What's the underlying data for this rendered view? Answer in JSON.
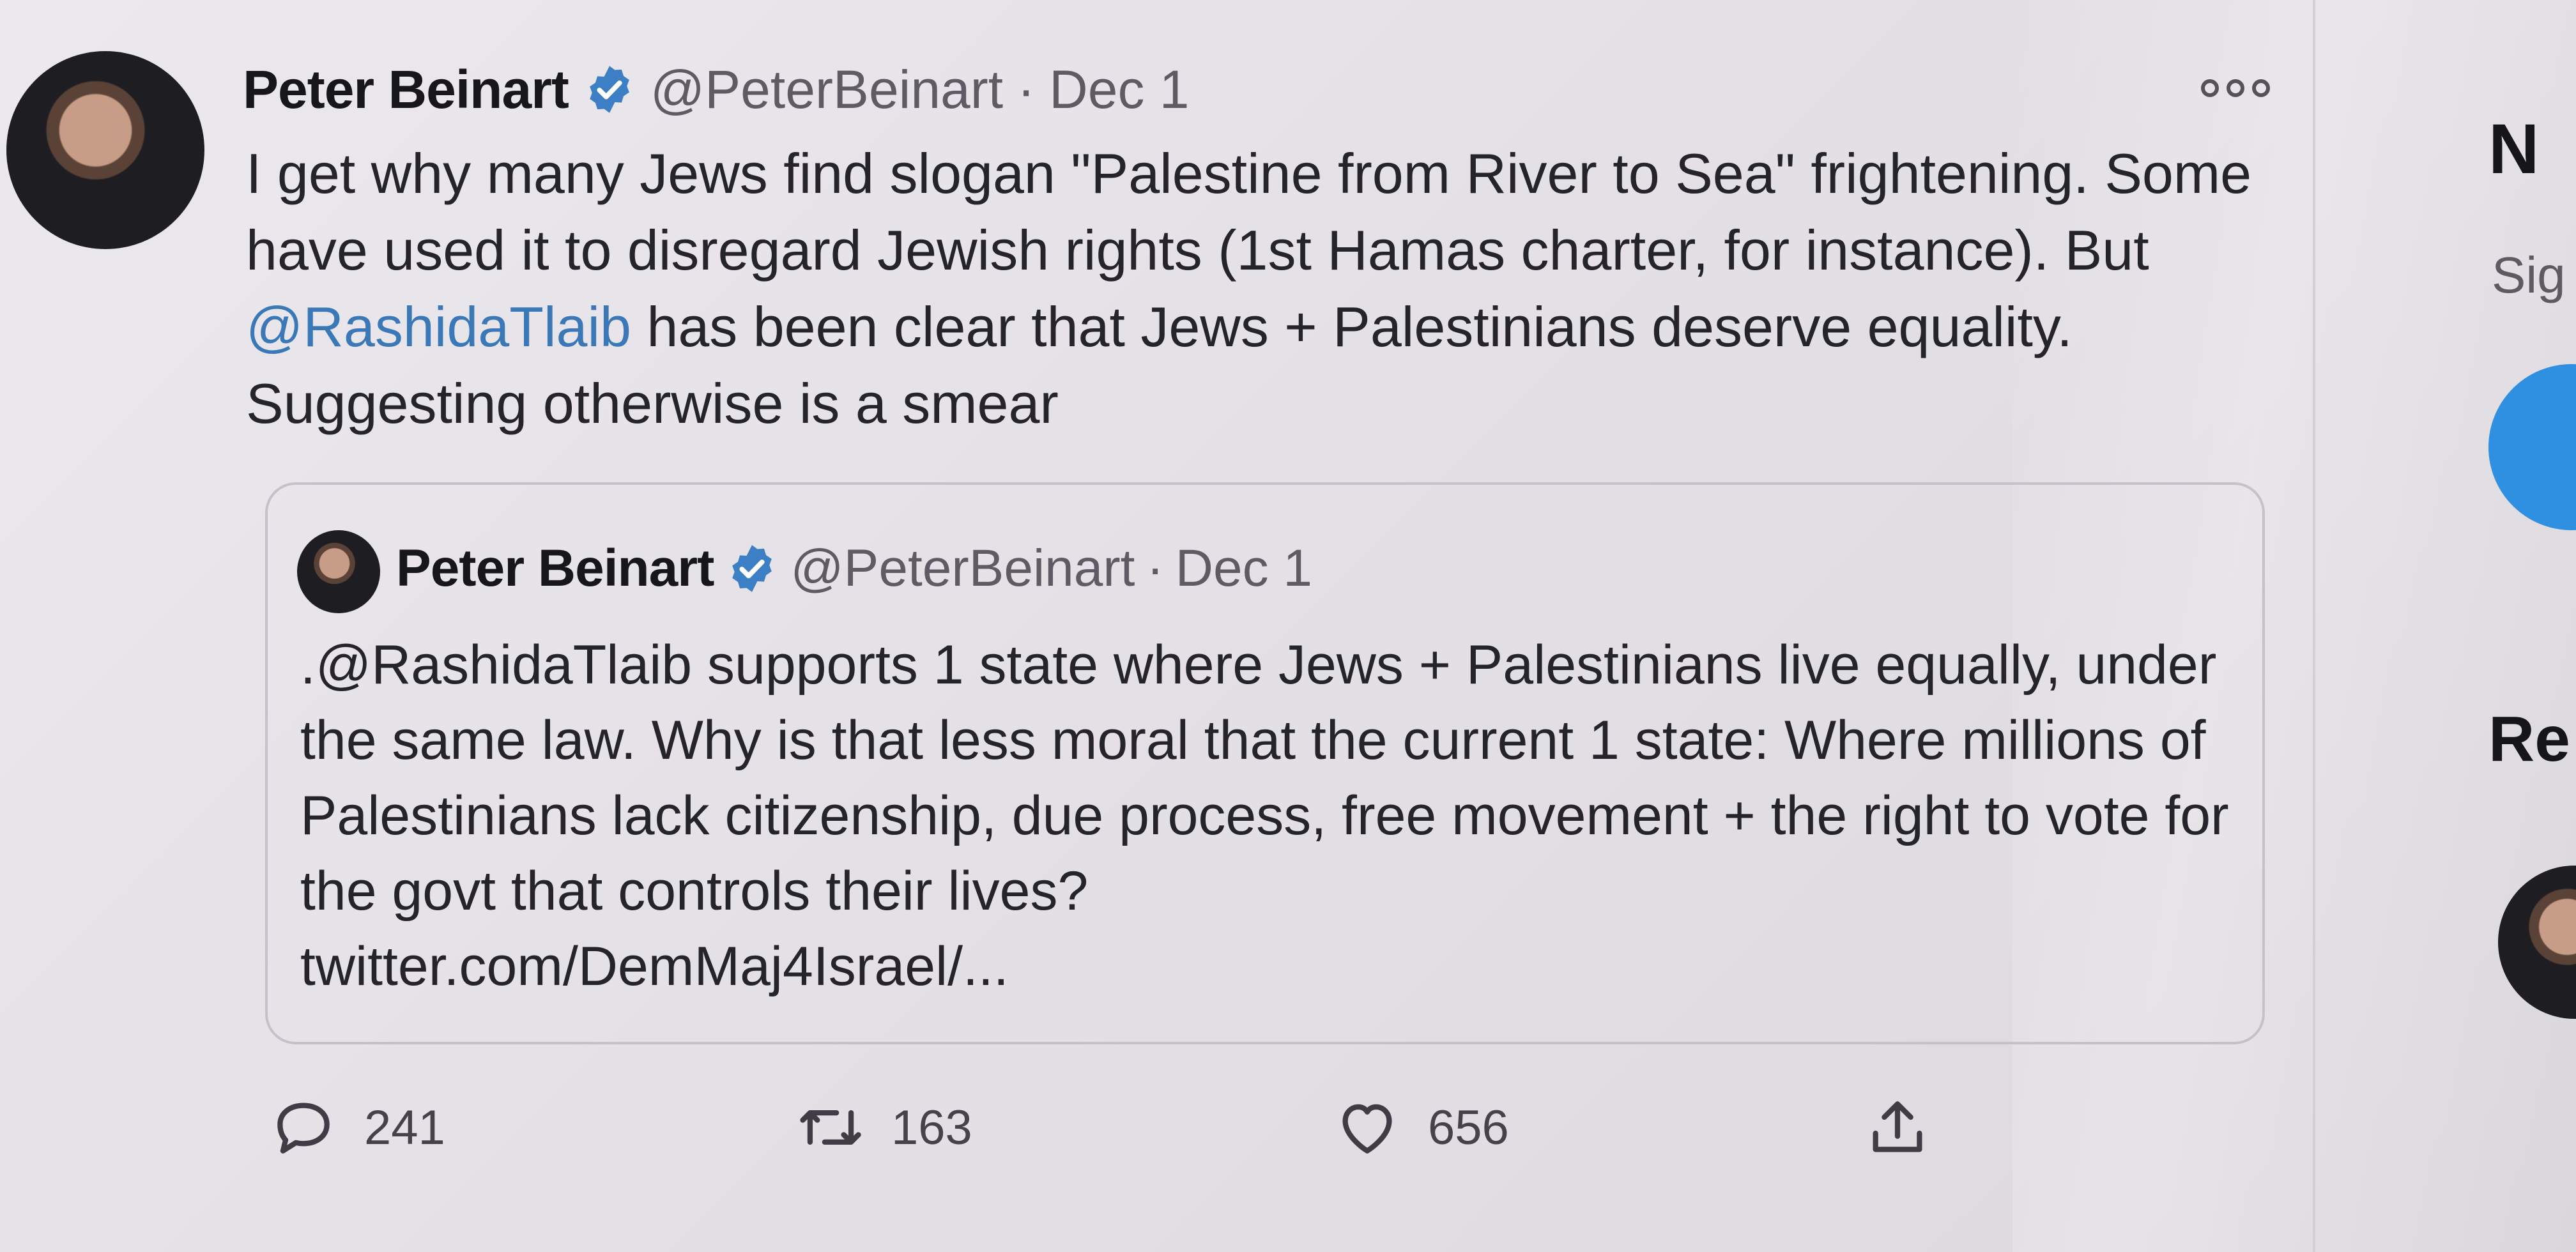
{
  "tweet": {
    "author_name": "Peter Beinart",
    "handle": "@PeterBeinart",
    "separator": "·",
    "date": "Dec 1",
    "text_before_mention": "I get why many Jews find slogan \"Palestine from River to Sea\" frightening. Some have used it to disregard Jewish rights (1st Hamas charter, for instance). But ",
    "mention": "@RashidaTlaib",
    "text_after_mention": " has been clear that Jews + Palestinians deserve equality. Suggesting otherwise is a smear"
  },
  "quoted_tweet": {
    "author_name": "Peter Beinart",
    "handle": "@PeterBeinart",
    "separator": "·",
    "date": "Dec 1",
    "text": ".@RashidaTlaib supports 1 state where Jews + Palestinians live equally, under the same law. Why is that less moral that the current 1 state: Where millions of Palestinians lack citizenship, due process, free movement + the right to vote for the govt that controls their lives?",
    "link": "twitter.com/DemMaj4Israel/..."
  },
  "actions": {
    "replies": "241",
    "retweets": "163",
    "likes": "656"
  },
  "sidebar": {
    "heading_top": "N",
    "signup_text": "Sig",
    "heading_bottom": "Re"
  },
  "icons": [
    "verified-badge-icon",
    "more-options-icon",
    "reply-icon",
    "retweet-icon",
    "like-icon",
    "share-icon"
  ],
  "colors": {
    "mention": "#3b78b8",
    "verified": "#3d7fc4",
    "sidebar_button": "#2f8fe0"
  }
}
